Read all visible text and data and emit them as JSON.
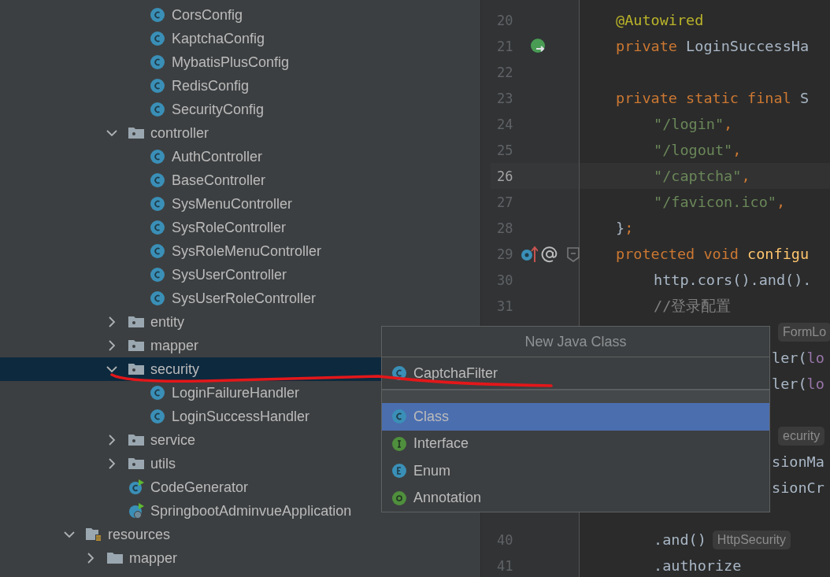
{
  "project_tree": [
    {
      "children": [
        {
          "children": [
            {
              "children": [
                {
                  "label": "CorsConfig",
                  "kind": "class",
                  "selected": false
                },
                {
                  "label": "KaptchaConfig",
                  "kind": "class",
                  "selected": false
                },
                {
                  "label": "MybatisPlusConfig",
                  "kind": "class",
                  "selected": false
                },
                {
                  "label": "RedisConfig",
                  "kind": "class",
                  "selected": false
                },
                {
                  "label": "SecurityConfig",
                  "kind": "class",
                  "selected": false
                }
              ]
            },
            {
              "label": "controller",
              "kind": "package",
              "expanded": true,
              "selected": false,
              "children": [
                {
                  "label": "AuthController",
                  "kind": "class",
                  "selected": false
                },
                {
                  "label": "BaseController",
                  "kind": "class",
                  "selected": false
                },
                {
                  "label": "SysMenuController",
                  "kind": "class",
                  "selected": false
                },
                {
                  "label": "SysRoleController",
                  "kind": "class",
                  "selected": false
                },
                {
                  "label": "SysRoleMenuController",
                  "kind": "class",
                  "selected": false
                },
                {
                  "label": "SysUserController",
                  "kind": "class",
                  "selected": false
                },
                {
                  "label": "SysUserRoleController",
                  "kind": "class",
                  "selected": false
                }
              ]
            },
            {
              "label": "entity",
              "kind": "package",
              "expanded": false,
              "selected": false
            },
            {
              "label": "mapper",
              "kind": "package",
              "expanded": false,
              "selected": false
            },
            {
              "label": "security",
              "kind": "package",
              "expanded": true,
              "selected": true,
              "children": [
                {
                  "label": "LoginFailureHandler",
                  "kind": "class",
                  "selected": false
                },
                {
                  "label": "LoginSuccessHandler",
                  "kind": "class",
                  "selected": false
                }
              ]
            },
            {
              "label": "service",
              "kind": "package",
              "expanded": false,
              "selected": false
            },
            {
              "label": "utils",
              "kind": "package",
              "expanded": false,
              "selected": false
            },
            {
              "label": "CodeGenerator",
              "kind": "runnable",
              "selected": false
            },
            {
              "label": "SpringbootAdminvueApplication",
              "kind": "app",
              "selected": false
            }
          ]
        }
      ]
    },
    {
      "label": "resources",
      "kind": "resources",
      "expanded": true,
      "selected": false,
      "children": [
        {
          "label": "mapper",
          "kind": "folder",
          "expanded": false,
          "selected": false
        }
      ]
    }
  ],
  "editor": {
    "lines": [
      {
        "number": "20",
        "indented": false,
        "current": false,
        "covered": false,
        "tokens": [
          {
            "kind": "annotation",
            "text": "@Autowired"
          }
        ]
      },
      {
        "number": "21",
        "indented": false,
        "current": false,
        "covered": false,
        "kind": "bean",
        "tokens": [
          {
            "kind": "keyword",
            "text": "private "
          },
          {
            "kind": "plain",
            "text": "LoginSuccessHa"
          }
        ]
      },
      {
        "number": "22"
      },
      {
        "number": "23",
        "indented": false,
        "current": false,
        "covered": false,
        "tokens": [
          {
            "kind": "keyword",
            "text": "private static final "
          },
          {
            "kind": "plain",
            "text": "S"
          }
        ]
      },
      {
        "number": "24",
        "indented": true,
        "current": false,
        "covered": false,
        "tokens": [
          {
            "kind": "string",
            "text": "\"/login\""
          },
          {
            "kind": "keyword",
            "text": ","
          }
        ]
      },
      {
        "number": "25",
        "indented": true,
        "current": false,
        "covered": false,
        "tokens": [
          {
            "kind": "string",
            "text": "\"/logout\""
          },
          {
            "kind": "keyword",
            "text": ","
          }
        ]
      },
      {
        "number": "26",
        "indented": true,
        "current": true,
        "covered": false,
        "tokens": [
          {
            "kind": "string",
            "text": "\"/captcha\""
          },
          {
            "kind": "keyword",
            "text": ","
          }
        ]
      },
      {
        "number": "27",
        "indented": true,
        "current": false,
        "covered": false,
        "tokens": [
          {
            "kind": "string",
            "text": "\"/favicon.ico\""
          },
          {
            "kind": "keyword",
            "text": ","
          }
        ]
      },
      {
        "number": "28",
        "indented": false,
        "current": false,
        "covered": false,
        "tokens": [
          {
            "kind": "plain",
            "text": "}"
          },
          {
            "kind": "keyword",
            "text": ";"
          }
        ]
      },
      {
        "number": "29",
        "indented": false,
        "current": false,
        "covered": false,
        "kind": "override",
        "tokens": [
          {
            "kind": "keyword",
            "text": "protected void "
          },
          {
            "kind": "method",
            "text": "configu"
          }
        ]
      },
      {
        "number": "30",
        "indented": true,
        "current": false,
        "covered": false,
        "tokens": [
          {
            "kind": "plain",
            "text": "http.cors().and()."
          }
        ]
      },
      {
        "number": "31",
        "indented": true,
        "current": false,
        "covered": false,
        "tokens": [
          {
            "kind": "comment",
            "text": "//登录配置"
          }
        ]
      },
      {
        "indented": true,
        "current": false,
        "covered": true,
        "tokens": [
          {
            "kind": "hint",
            "text": "FormLo"
          }
        ]
      },
      {
        "indented": true,
        "current": false,
        "covered": true,
        "tokens": [
          {
            "kind": "plain",
            "text": "ler("
          },
          {
            "kind": "field",
            "text": "lo"
          }
        ]
      },
      {
        "indented": true,
        "current": false,
        "covered": true,
        "tokens": [
          {
            "kind": "plain",
            "text": "ler("
          },
          {
            "kind": "field",
            "text": "lo"
          }
        ]
      },
      {
        "kind": "blank"
      },
      {
        "indented": true,
        "current": false,
        "covered": true,
        "tokens": [
          {
            "kind": "hint",
            "text": "ecurity"
          }
        ]
      },
      {
        "indented": true,
        "current": false,
        "covered": true,
        "tokens": [
          {
            "kind": "plain",
            "text": "sionMa"
          }
        ]
      },
      {
        "indented": true,
        "current": false,
        "covered": true,
        "tokens": [
          {
            "kind": "plain",
            "text": "sionCr"
          }
        ]
      },
      {
        "kind": "blank"
      },
      {
        "number": "40",
        "indented": true,
        "current": false,
        "covered": false,
        "tokens": [
          {
            "kind": "plain",
            "text": ".and()"
          },
          {
            "kind": "hint",
            "text": "HttpSecurity"
          }
        ]
      },
      {
        "number": "41",
        "indented": true,
        "current": false,
        "covered": false,
        "tokens": [
          {
            "kind": "plain",
            "text": ".authorize"
          }
        ]
      }
    ]
  },
  "new_class_popup": {
    "title": "New Java Class",
    "name_value": "CaptchaFilter",
    "options": [
      {
        "label": "Class",
        "kind": "class",
        "selected": true
      },
      {
        "label": "Interface",
        "kind": "interface",
        "selected": false
      },
      {
        "label": "Enum",
        "kind": "enum",
        "selected": false
      },
      {
        "label": "Annotation",
        "kind": "annotation",
        "selected": false
      }
    ]
  }
}
